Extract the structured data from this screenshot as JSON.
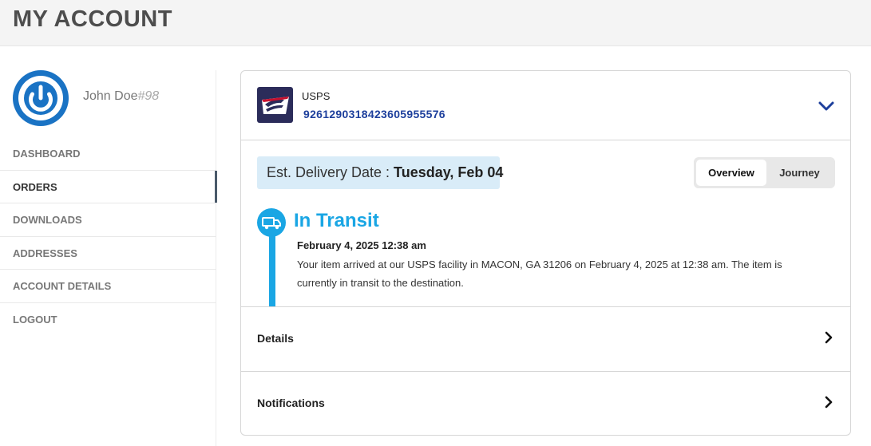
{
  "page": {
    "title": "MY ACCOUNT"
  },
  "profile": {
    "name": "John Doe",
    "id": "#98",
    "avatar_icon": "power-icon",
    "avatar_color": "#1a73c4"
  },
  "nav": {
    "items": [
      {
        "label": "DASHBOARD",
        "active": false
      },
      {
        "label": "ORDERS",
        "active": true
      },
      {
        "label": "DOWNLOADS",
        "active": false
      },
      {
        "label": "ADDRESSES",
        "active": false
      },
      {
        "label": "ACCOUNT DETAILS",
        "active": false
      },
      {
        "label": "LOGOUT",
        "active": false
      }
    ]
  },
  "shipment": {
    "carrier": "USPS",
    "carrier_logo_icon": "usps-eagle-logo",
    "tracking_number": "9261290318423605955576",
    "expand_icon": "chevron-down-icon",
    "est_delivery_label": "Est. Delivery Date : ",
    "est_delivery_date": "Tuesday, Feb 04",
    "view_toggle": {
      "options": [
        "Overview",
        "Journey"
      ],
      "selected": "Overview"
    },
    "status": {
      "title": "In Transit",
      "icon": "truck-icon",
      "color": "#1aa6e4"
    },
    "latest_event": {
      "time": "February 4, 2025 12:38 am",
      "description": "Your item arrived at our USPS facility in MACON, GA 31206 on February 4, 2025 at 12:38 am. The item is currently in transit to the destination."
    },
    "sections": [
      {
        "label": "Details",
        "icon": "chevron-right-icon"
      },
      {
        "label": "Notifications",
        "icon": "chevron-right-icon"
      }
    ]
  }
}
